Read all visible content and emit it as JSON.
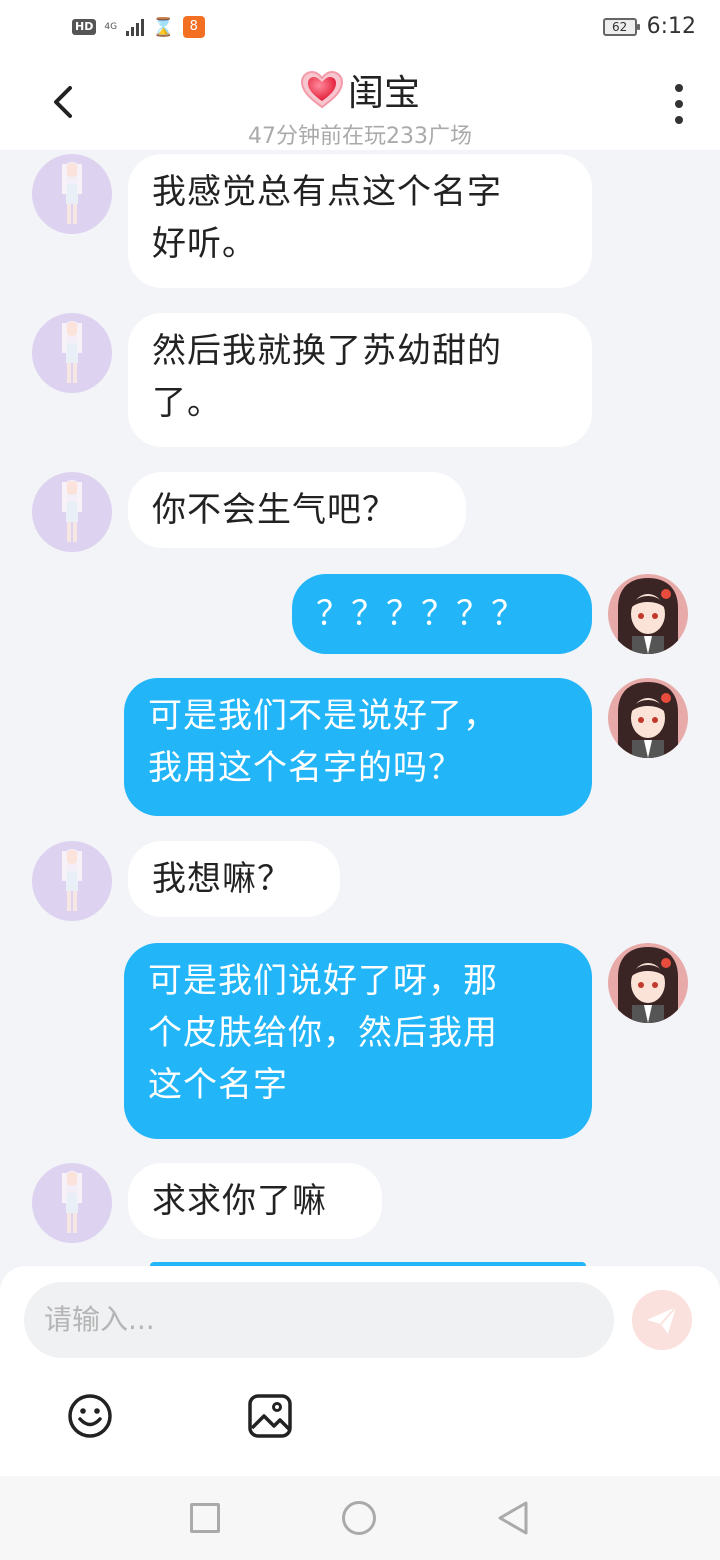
{
  "status_bar": {
    "hd": "HD",
    "network": "4G",
    "battery": "62",
    "time": "6:12"
  },
  "header": {
    "title": "闺宝",
    "subtitle": "47分钟前在玩233广场"
  },
  "messages": [
    {
      "from": "other",
      "text": "我感觉总有点这个名字\n好听。"
    },
    {
      "from": "other",
      "text": "然后我就换了苏幼甜的\n了。"
    },
    {
      "from": "other",
      "text": "你不会生气吧？"
    },
    {
      "from": "me",
      "text": "？？？？？？"
    },
    {
      "from": "me",
      "text": "可是我们不是说好了，\n我用这个名字的吗？"
    },
    {
      "from": "other",
      "text": "我想嘛？"
    },
    {
      "from": "me",
      "text": "可是我们说好了呀，那\n个皮肤给你，然后我用\n这个名字"
    },
    {
      "from": "other",
      "text": "求求你了嘛"
    }
  ],
  "input": {
    "placeholder": "请输入..."
  },
  "icons": {
    "back": "chevron-left-icon",
    "more": "more-vertical-icon",
    "heart": "heart-icon",
    "send": "send-icon",
    "emoji": "smile-icon",
    "image": "image-icon"
  },
  "colors": {
    "outgoing_bubble": "#22b5f8",
    "incoming_bubble": "#ffffff",
    "background": "#f2f4f7"
  }
}
